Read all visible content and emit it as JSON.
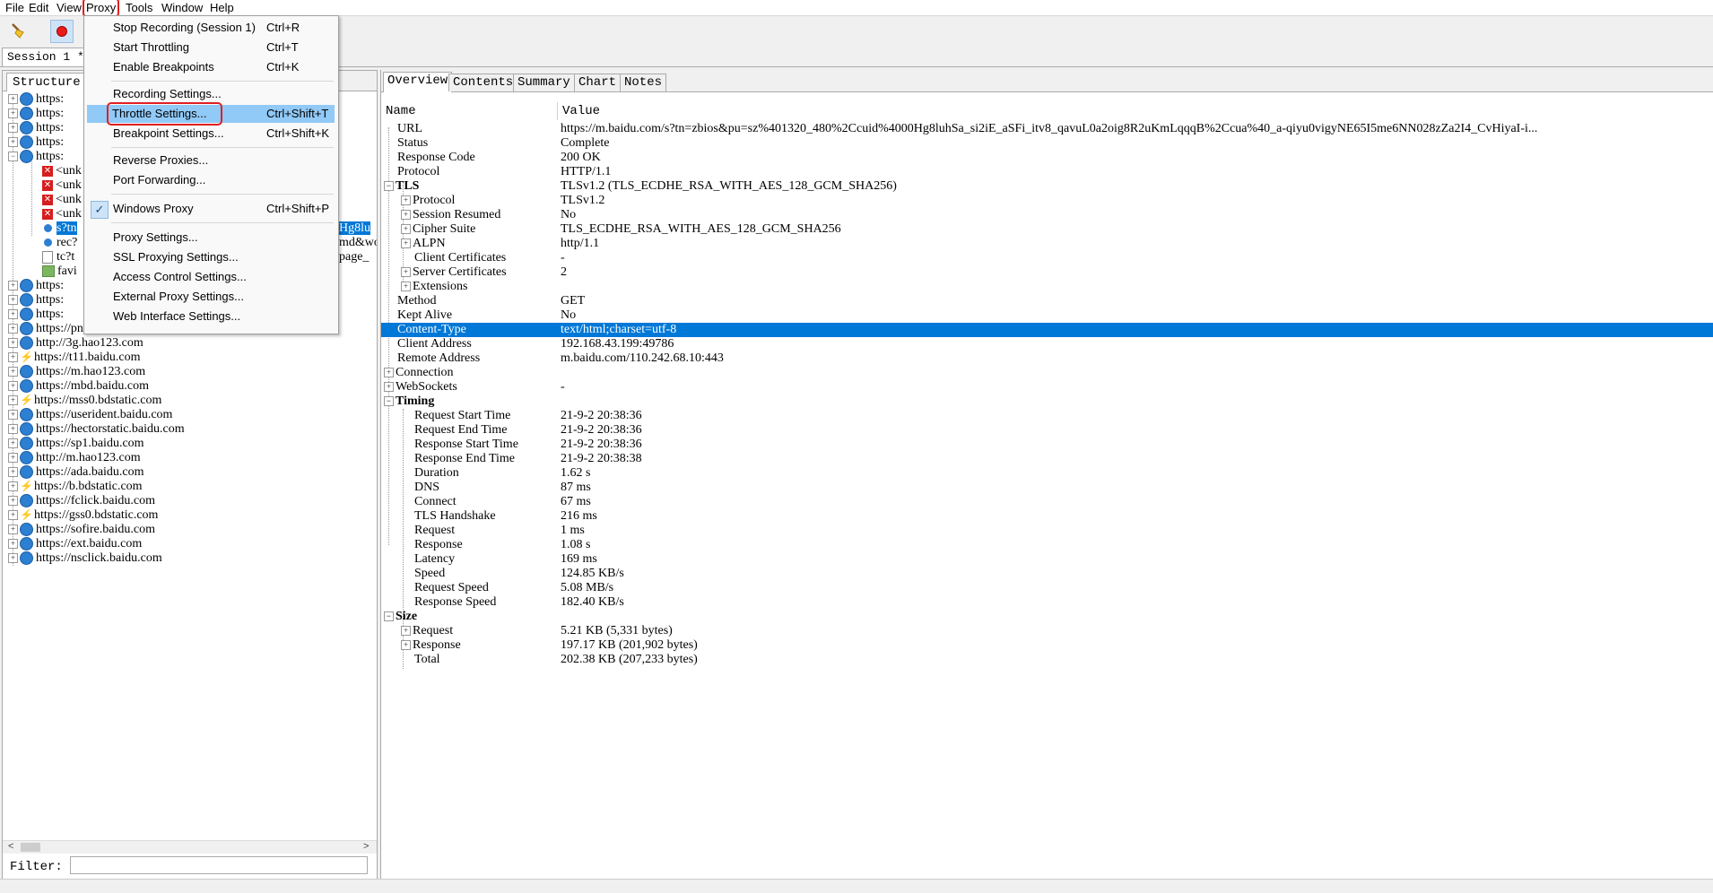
{
  "menubar": {
    "items": [
      "File",
      "Edit",
      "View",
      "Proxy",
      "Tools",
      "Window",
      "Help"
    ]
  },
  "session": {
    "tab": "Session 1 *"
  },
  "left": {
    "tab": "Structure",
    "tree": [
      "https:",
      "https:",
      "https:",
      "https:",
      "https:",
      "<unk",
      "<unk",
      "<unk",
      "<unk",
      "s?tn",
      "rec?",
      "tc?t",
      "favi",
      "https:",
      "https:",
      "https:",
      "https://pnrt-stsdk.vivo.com.cn",
      "http://3g.hao123.com",
      "https://t11.baidu.com",
      "https://m.hao123.com",
      "https://mbd.baidu.com",
      "https://mss0.bdstatic.com",
      "https://userident.baidu.com",
      "https://hectorstatic.baidu.com",
      "https://sp1.baidu.com",
      "http://m.hao123.com",
      "https://ada.baidu.com",
      "https://b.bdstatic.com",
      "https://fclick.baidu.com",
      "https://gss0.bdstatic.com",
      "https://sofire.baidu.com",
      "https://ext.baidu.com",
      "https://nsclick.baidu.com"
    ],
    "overflow": [
      "Hg8lu",
      "md&wo",
      "page_"
    ],
    "filter_label": "Filter:",
    "filter_value": ""
  },
  "right": {
    "tabs": [
      "Overview",
      "Contents",
      "Summary",
      "Chart",
      "Notes"
    ],
    "header": {
      "name": "Name",
      "value": "Value"
    },
    "rows": [
      {
        "n": "URL",
        "v": "https://m.baidu.com/s?tn=zbios&pu=sz%401320_480%2Ccuid%4000Hg8luhSa_si2iE_aSFi_itv8_qavuL0a2oig8R2uKmLqqqB%2Ccua%40_a-qiyu0vigyNE65I5me6NN028zZa2I4_CvHiyaI-i..."
      },
      {
        "n": "Status",
        "v": "Complete"
      },
      {
        "n": "Response Code",
        "v": "200 OK"
      },
      {
        "n": "Protocol",
        "v": "HTTP/1.1"
      },
      {
        "n": "TLS",
        "v": "TLSv1.2 (TLS_ECDHE_RSA_WITH_AES_128_GCM_SHA256)"
      },
      {
        "n": "Protocol",
        "v": "TLSv1.2"
      },
      {
        "n": "Session Resumed",
        "v": "No"
      },
      {
        "n": "Cipher Suite",
        "v": "TLS_ECDHE_RSA_WITH_AES_128_GCM_SHA256"
      },
      {
        "n": "ALPN",
        "v": "http/1.1"
      },
      {
        "n": "Client Certificates",
        "v": "-"
      },
      {
        "n": "Server Certificates",
        "v": "2"
      },
      {
        "n": "Extensions",
        "v": ""
      },
      {
        "n": "Method",
        "v": "GET"
      },
      {
        "n": "Kept Alive",
        "v": "No"
      },
      {
        "n": "Content-Type",
        "v": "text/html;charset=utf-8"
      },
      {
        "n": "Client Address",
        "v": "192.168.43.199:49786"
      },
      {
        "n": "Remote Address",
        "v": "m.baidu.com/110.242.68.10:443"
      },
      {
        "n": "Connection",
        "v": ""
      },
      {
        "n": "WebSockets",
        "v": "-"
      },
      {
        "n": "Timing",
        "v": ""
      },
      {
        "n": "Request Start Time",
        "v": "21-9-2 20:38:36"
      },
      {
        "n": "Request End Time",
        "v": "21-9-2 20:38:36"
      },
      {
        "n": "Response Start Time",
        "v": "21-9-2 20:38:36"
      },
      {
        "n": "Response End Time",
        "v": "21-9-2 20:38:38"
      },
      {
        "n": "Duration",
        "v": "1.62 s"
      },
      {
        "n": "DNS",
        "v": "87 ms"
      },
      {
        "n": "Connect",
        "v": "67 ms"
      },
      {
        "n": "TLS Handshake",
        "v": "216 ms"
      },
      {
        "n": "Request",
        "v": "1 ms"
      },
      {
        "n": "Response",
        "v": "1.08 s"
      },
      {
        "n": "Latency",
        "v": "169 ms"
      },
      {
        "n": "Speed",
        "v": "124.85 KB/s"
      },
      {
        "n": "Request Speed",
        "v": "5.08 MB/s"
      },
      {
        "n": "Response Speed",
        "v": "182.40 KB/s"
      },
      {
        "n": "Size",
        "v": ""
      },
      {
        "n": "Request",
        "v": "5.21 KB (5,331 bytes)"
      },
      {
        "n": "Response",
        "v": "197.17 KB (201,902 bytes)"
      },
      {
        "n": "Total",
        "v": "202.38 KB (207,233 bytes)"
      }
    ]
  },
  "proxy_menu": {
    "items": [
      {
        "label": "Stop Recording (Session 1)",
        "shortcut": "Ctrl+R"
      },
      {
        "label": "Start Throttling",
        "shortcut": "Ctrl+T"
      },
      {
        "label": "Enable Breakpoints",
        "shortcut": "Ctrl+K"
      },
      {
        "label": "Recording Settings...",
        "shortcut": ""
      },
      {
        "label": "Throttle Settings...",
        "shortcut": "Ctrl+Shift+T"
      },
      {
        "label": "Breakpoint Settings...",
        "shortcut": "Ctrl+Shift+K"
      },
      {
        "label": "Reverse Proxies...",
        "shortcut": ""
      },
      {
        "label": "Port Forwarding...",
        "shortcut": ""
      },
      {
        "label": "Windows Proxy",
        "shortcut": "Ctrl+Shift+P"
      },
      {
        "label": "Proxy Settings...",
        "shortcut": ""
      },
      {
        "label": "SSL Proxying Settings...",
        "shortcut": ""
      },
      {
        "label": "Access Control Settings...",
        "shortcut": ""
      },
      {
        "label": "External Proxy Settings...",
        "shortcut": ""
      },
      {
        "label": "Web Interface Settings...",
        "shortcut": ""
      }
    ],
    "checked_icon": "check-icon"
  },
  "colors": {
    "selection": "#0078d7",
    "highlight_box": "#e02020",
    "menu_hover": "#91c9f7"
  }
}
